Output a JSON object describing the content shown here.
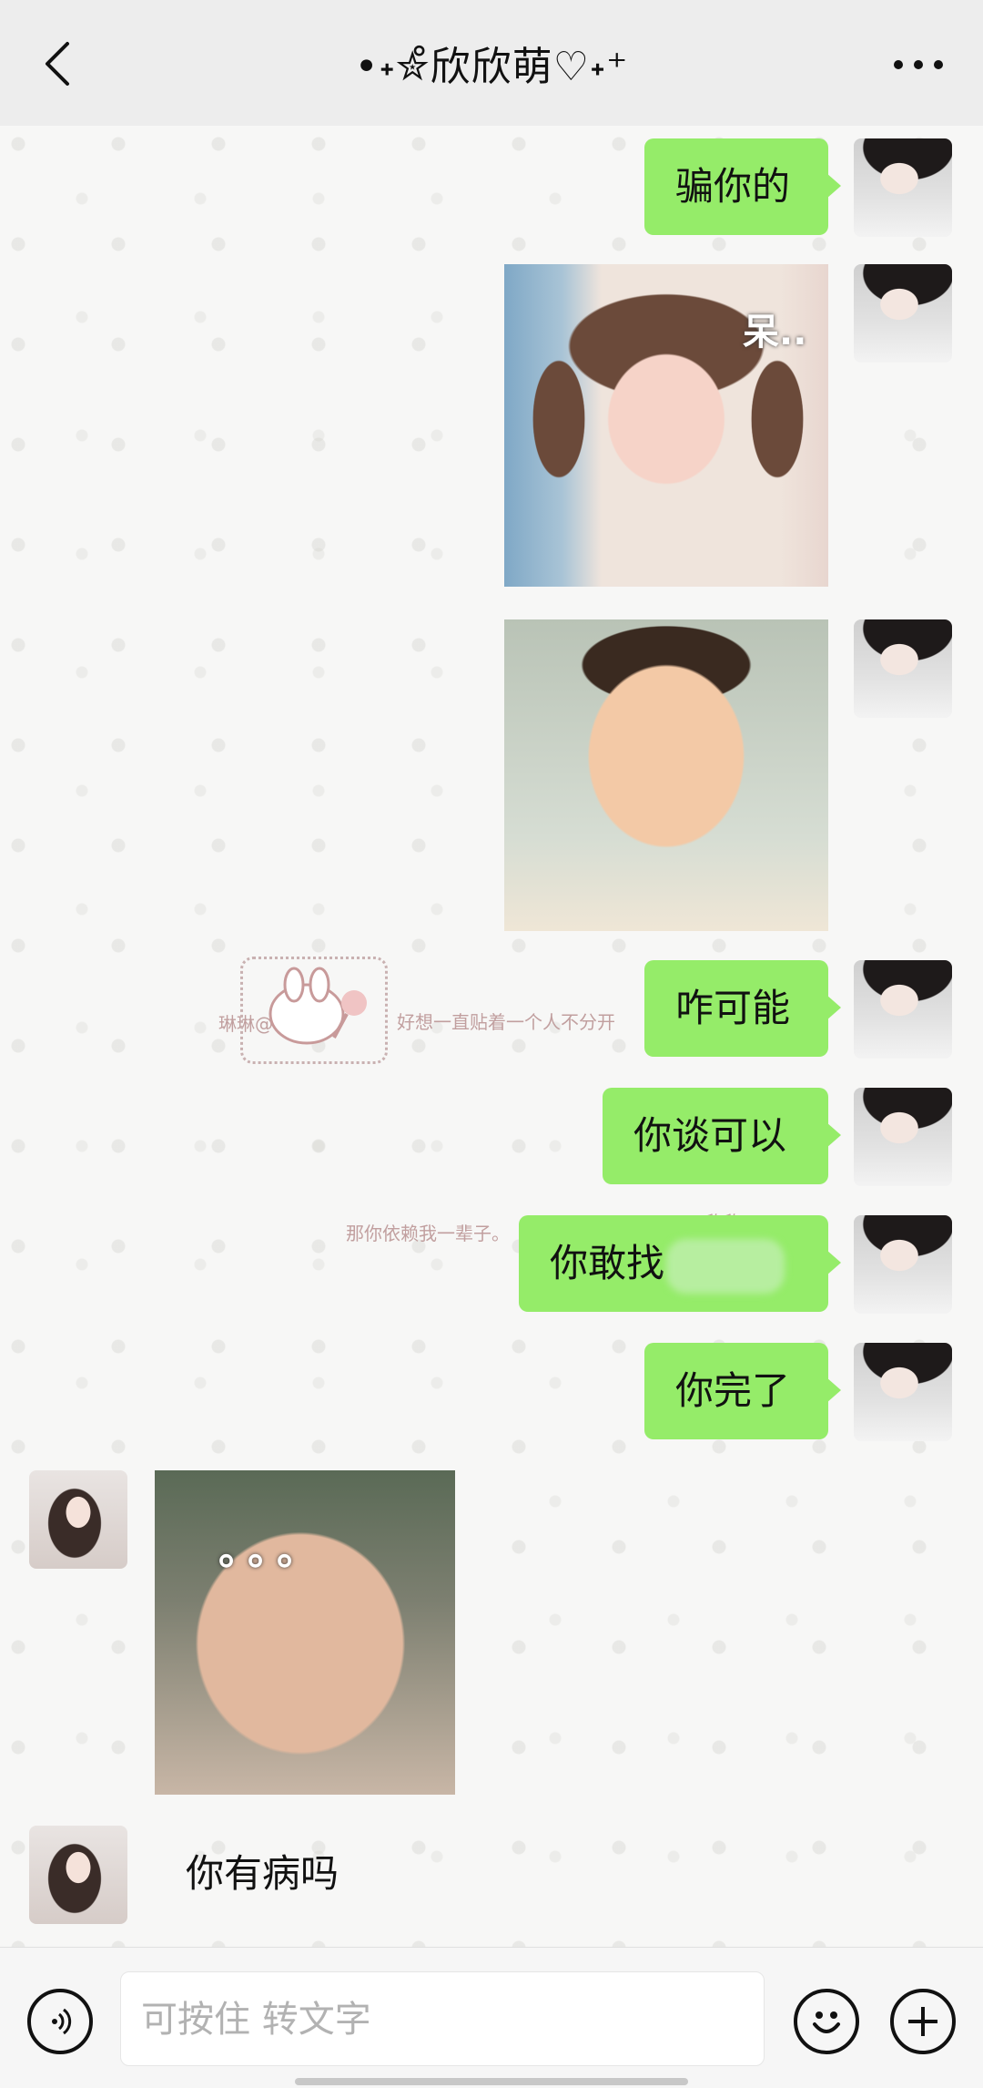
{
  "header": {
    "title": "•˖✮̊欣欣萌♡˖⁺",
    "back_icon": "chevron-left-icon",
    "more_icon": "ellipsis-icon"
  },
  "messages": [
    {
      "from": "me",
      "type": "text",
      "text": "骗你的"
    },
    {
      "from": "me",
      "type": "image",
      "caption": "呆.."
    },
    {
      "from": "me",
      "type": "image",
      "caption": ""
    },
    {
      "from": "me",
      "type": "text",
      "text": "咋可能"
    },
    {
      "from": "me",
      "type": "text",
      "text": "你谈可以"
    },
    {
      "from": "me",
      "type": "text",
      "text": "你敢找"
    },
    {
      "from": "me",
      "type": "text",
      "text": "你完了"
    },
    {
      "from": "her",
      "type": "image",
      "caption": "。。。"
    },
    {
      "from": "her",
      "type": "text",
      "text": "你有病吗"
    }
  ],
  "background_stickers": [
    "琳琳@",
    "好想一直贴着一个人不分开",
    "那你依赖我一辈子。",
    "@欣欣"
  ],
  "input": {
    "placeholder": "可按住 转文字",
    "voice_icon": "voice-icon",
    "emoji_icon": "emoji-icon",
    "plus_icon": "plus-icon"
  },
  "colors": {
    "bubble_green": "#95ec69",
    "header_bg": "#ededed",
    "chat_bg": "#f7f7f6"
  }
}
